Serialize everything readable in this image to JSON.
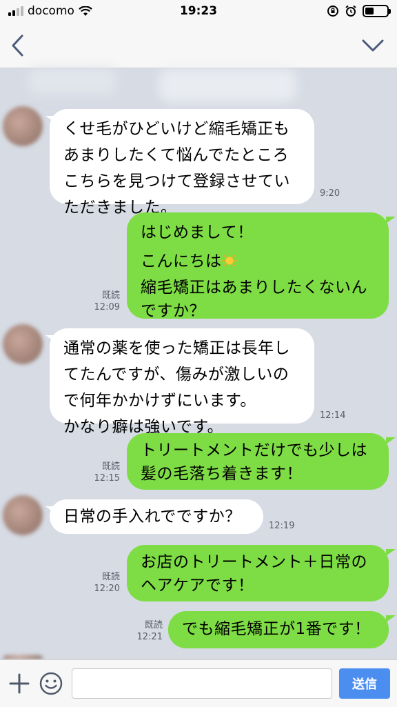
{
  "status_bar": {
    "carrier": "docomo",
    "time": "19:23"
  },
  "navbar": {
    "title": ""
  },
  "messages": [
    {
      "dir": "in",
      "lines": [
        "くせ毛がひどいけど縮毛矯正も",
        "あまりしたくて悩んでたところ",
        "こちらを見つけて登録させてい",
        "ただきました。"
      ],
      "time": "9:20"
    },
    {
      "dir": "out",
      "paragraphs": [
        "はじめまして！",
        "こんにちは",
        "縮毛矯正はあまりしたくないん",
        "ですか？"
      ],
      "read": "既読",
      "time": "12:09"
    },
    {
      "dir": "in",
      "lines": [
        "通常の薬を使った矯正は長年し",
        "てたんですが、傷みが激しいの",
        "で何年かかけずにいます。",
        "かなり癖は強いです。"
      ],
      "time": "12:14"
    },
    {
      "dir": "out",
      "lines": [
        "トリートメントだけでも少しは",
        "髪の毛落ち着きます！"
      ],
      "read": "既読",
      "time": "12:15"
    },
    {
      "dir": "in",
      "lines": [
        "日常の手入れでですか？"
      ],
      "time": "12:19"
    },
    {
      "dir": "out",
      "lines": [
        "お店のトリートメント＋日常の",
        "ヘアケアです！"
      ],
      "read": "既読",
      "time": "12:20"
    },
    {
      "dir": "out",
      "lines": [
        "でも縮毛矯正が1番です！"
      ],
      "read": "既読",
      "time": "12:21"
    }
  ],
  "input": {
    "placeholder": "",
    "send_label": "送信"
  },
  "colors": {
    "background": "#d6dbe4",
    "outgoing": "#7edd45",
    "incoming": "#ffffff",
    "send": "#4c8df0"
  },
  "icons": [
    "back-chevron-icon",
    "chevron-down-icon",
    "plus-icon",
    "emoji-icon",
    "sun-emoji-icon",
    "wifi-icon",
    "alarm-icon",
    "battery-icon"
  ]
}
